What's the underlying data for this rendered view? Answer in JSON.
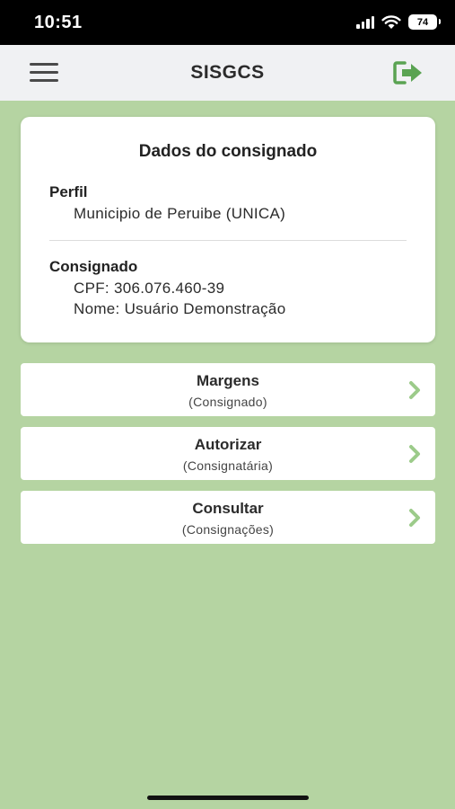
{
  "status_bar": {
    "time": "10:51",
    "battery": "74"
  },
  "app_bar": {
    "title": "SISGCS"
  },
  "profile_card": {
    "title": "Dados do consignado",
    "perfil_label": "Perfil",
    "perfil_value": "Municipio de Peruibe (UNICA)",
    "consignado_label": "Consignado",
    "cpf": "CPF: 306.076.460-39",
    "nome": "Nome: Usuário Demonstração"
  },
  "menu": [
    {
      "title": "Margens",
      "subtitle": "(Consignado)"
    },
    {
      "title": "Autorizar",
      "subtitle": "(Consignatária)"
    },
    {
      "title": "Consultar",
      "subtitle": "(Consignações)"
    }
  ],
  "colors": {
    "background": "#b5d4a2",
    "accent": "#5aa352",
    "chevron": "#9ccb8a"
  }
}
